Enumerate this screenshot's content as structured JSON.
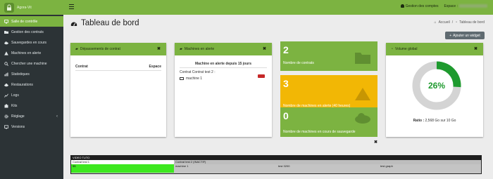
{
  "brand": {
    "name": "Agora-Vit"
  },
  "sidebar": {
    "items": [
      {
        "label": "Salle de contrôle",
        "icon": "monitor-icon",
        "active": true
      },
      {
        "label": "Gestion des contrats",
        "icon": "folder-icon"
      },
      {
        "label": "Sauvegardes en cours",
        "icon": "cloud-icon"
      },
      {
        "label": "Machines en alerte",
        "icon": "warning-icon"
      },
      {
        "label": "Chercher une machine",
        "icon": "search-icon"
      },
      {
        "label": "Statistiques",
        "icon": "chart-icon"
      },
      {
        "label": "Restaurations",
        "icon": "restore-icon"
      },
      {
        "label": "Logs",
        "icon": "logs-icon"
      },
      {
        "label": "Kits",
        "icon": "kits-icon"
      },
      {
        "label": "Réglage",
        "icon": "gear-icon",
        "has_submenu": true
      },
      {
        "label": "Versions",
        "icon": "versions-icon"
      }
    ]
  },
  "topbar": {
    "accounts_label": "Gestion des comptes",
    "space_label": "Espace :"
  },
  "page": {
    "title": "Tableau de bord",
    "breadcrumb": {
      "home": "Accueil",
      "separator": "/",
      "current": "Tableau de bord"
    },
    "add_widget_label": "Ajouter un widget"
  },
  "widgets": {
    "contracts_over": {
      "title": "Dépassements de contrat",
      "col_contract": "Contrat",
      "col_space": "Espace"
    },
    "machines_alert": {
      "title": "Machines en alerte",
      "subtitle": "Machine en alerte depuis 15 jours",
      "contract_line": "Contrat Contrat test 2 :",
      "machine": "machine 1"
    },
    "stats": [
      {
        "value": "2",
        "label": "Nombre de contrats",
        "color": "#7cb341",
        "icon": "folder-icon"
      },
      {
        "value": "3",
        "label": "Nombre de machines en alerte (40 heures)",
        "color": "#f2b705",
        "icon": "warning-icon"
      },
      {
        "value": "0",
        "label": "Nombre de machines en cours de sauvegarde",
        "color": "#7cb341",
        "icon": "cloud-download-icon"
      }
    ],
    "volume": {
      "title": "Volume global",
      "percent_label": "26%",
      "percent": 26,
      "ratio_label": "Ratio :",
      "ratio_value": "2,568 Go sur 10 Go"
    }
  },
  "video": {
    "title": "VIDEO TUTO",
    "row1_left": "Contrat test 1",
    "row1_right": "Contrat test 2 (INACTIF)",
    "row2_left": "$$",
    "row2_mid": "machine 1",
    "row2_c3": "test 3200",
    "row2_c4": "test graph"
  },
  "colors": {
    "brand_green": "#7cb341",
    "sidebar_bg": "#2c3336",
    "warning_yellow": "#f2b705",
    "alert_red": "#c62828"
  }
}
